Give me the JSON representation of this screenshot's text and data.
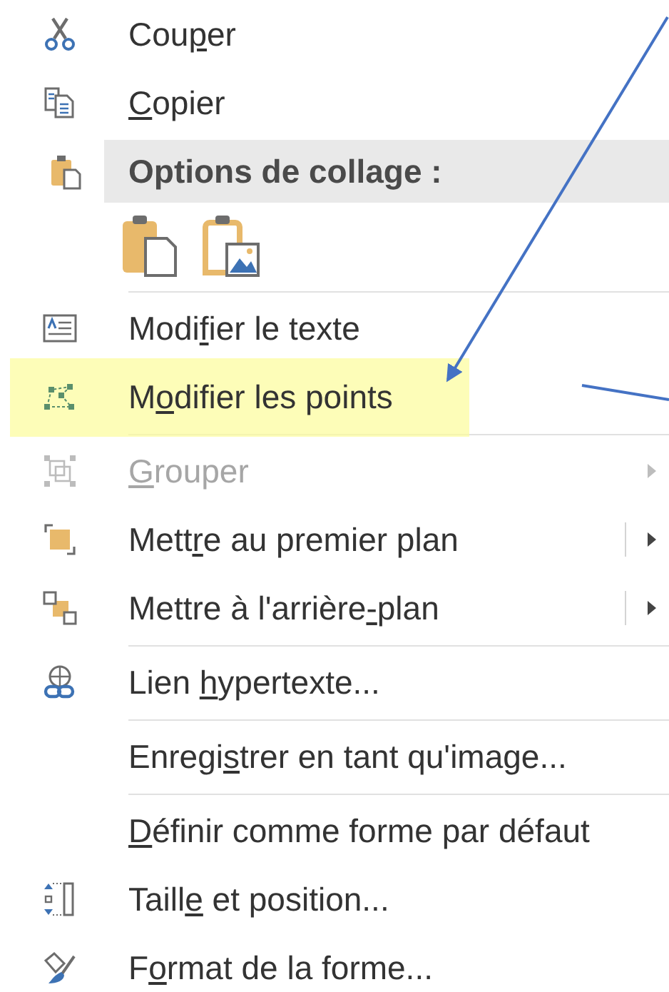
{
  "menu": [
    {
      "kind": "item",
      "label": {
        "pre": "Cou",
        "key": "p",
        "post": "er"
      },
      "disabled": false,
      "submenu": false,
      "split": false,
      "highlighted": false
    },
    {
      "kind": "item",
      "label": {
        "key": "C",
        "post": "opier"
      },
      "disabled": false,
      "submenu": false,
      "split": false,
      "highlighted": false
    },
    {
      "kind": "header",
      "text": "Options de collage :"
    },
    {
      "kind": "paste_options"
    },
    {
      "kind": "separator"
    },
    {
      "kind": "item",
      "label": {
        "pre": "Modi",
        "key": "f",
        "post": "ier le texte"
      },
      "disabled": false,
      "submenu": false,
      "split": false,
      "highlighted": false
    },
    {
      "kind": "item",
      "label": {
        "pre": "M",
        "key": "o",
        "post": "difier les points"
      },
      "disabled": false,
      "submenu": false,
      "split": false,
      "highlighted": true
    },
    {
      "kind": "separator"
    },
    {
      "kind": "item",
      "label": {
        "key": "G",
        "post": "rouper"
      },
      "disabled": true,
      "submenu": true,
      "split": false,
      "highlighted": false
    },
    {
      "kind": "item",
      "label": {
        "pre": "Mett",
        "key": "r",
        "post": "e au premier plan"
      },
      "disabled": false,
      "submenu": true,
      "split": true,
      "highlighted": false
    },
    {
      "kind": "item",
      "label": {
        "pre": "Mettre à l'arrière",
        "key": "-",
        "post": "plan"
      },
      "disabled": false,
      "submenu": true,
      "split": true,
      "highlighted": false
    },
    {
      "kind": "separator"
    },
    {
      "kind": "item",
      "label": {
        "pre": "Lien ",
        "key": "h",
        "post": "ypertexte..."
      },
      "disabled": false,
      "submenu": false,
      "split": false,
      "highlighted": false
    },
    {
      "kind": "separator"
    },
    {
      "kind": "item",
      "label": {
        "pre": "Enregi",
        "key": "s",
        "post": "trer en tant qu'image..."
      },
      "disabled": false,
      "submenu": false,
      "split": false,
      "highlighted": false
    },
    {
      "kind": "separator"
    },
    {
      "kind": "item",
      "label": {
        "key": "D",
        "post": "éfinir comme forme par défaut"
      },
      "disabled": false,
      "submenu": false,
      "split": false,
      "highlighted": false
    },
    {
      "kind": "item",
      "label": {
        "pre": "Taill",
        "key": "e",
        "post": " et position..."
      },
      "disabled": false,
      "submenu": false,
      "split": false,
      "highlighted": false
    },
    {
      "kind": "item",
      "label": {
        "pre": "F",
        "key": "o",
        "post": "rmat de la forme..."
      },
      "disabled": false,
      "submenu": false,
      "split": false,
      "highlighted": false
    }
  ]
}
